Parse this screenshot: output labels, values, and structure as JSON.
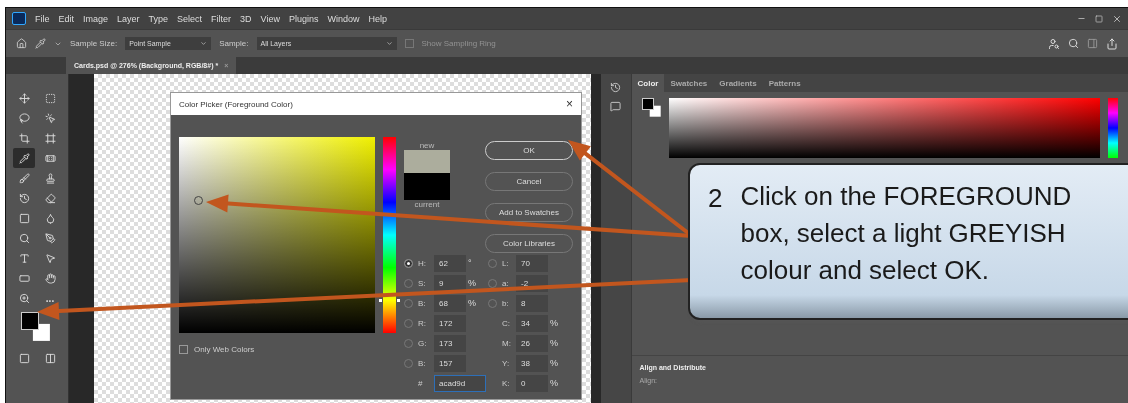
{
  "menu_bar": {
    "items": [
      "File",
      "Edit",
      "Image",
      "Layer",
      "Type",
      "Select",
      "Filter",
      "3D",
      "View",
      "Plugins",
      "Window",
      "Help"
    ]
  },
  "options_bar": {
    "sample_size_label": "Sample Size:",
    "sample_size": "Point Sample",
    "sample_label": "Sample:",
    "sample": "All Layers",
    "sampling_ring": {
      "label": "Show Sampling Ring",
      "checked": false,
      "disabled": true
    }
  },
  "document_tab": {
    "title": "Cards.psd @ 276% (Background, RGB/8#) *",
    "close": "×"
  },
  "toolbar": {
    "tools": [
      {
        "selected": false
      },
      {
        "selected": false
      },
      {
        "selected": false
      },
      {
        "selected": false
      },
      {
        "selected": false
      },
      {
        "selected": false
      },
      {
        "selected": true
      },
      {
        "selected": false
      },
      {
        "selected": false
      },
      {
        "selected": false
      },
      {
        "selected": false
      },
      {
        "selected": false
      },
      {
        "selected": false
      },
      {
        "selected": false
      },
      {
        "selected": false
      },
      {
        "selected": false
      },
      {
        "selected": false
      },
      {
        "selected": false
      },
      {
        "selected": false
      },
      {
        "selected": false
      },
      {
        "selected": false
      },
      {
        "selected": false
      }
    ],
    "more": "..."
  },
  "color_picker": {
    "title": "Color Picker (Foreground Color)",
    "close": "×",
    "hue_slider": {
      "level": 0.17
    },
    "new_label": "new",
    "current_label": "current",
    "buttons": [
      "OK",
      "Cancel",
      "Add to Swatches",
      "Color Libraries"
    ],
    "fields": [
      {
        "label": "H:",
        "value": "62",
        "unit": "°",
        "selected": true
      },
      {
        "label": "S:",
        "value": "9",
        "unit": "%",
        "selected": false
      },
      {
        "label": "B:",
        "value": "68",
        "unit": "%",
        "selected": false
      },
      {
        "label": "R:",
        "value": "172",
        "selected": false
      },
      {
        "label": "G:",
        "value": "173",
        "selected": false
      },
      {
        "label": "B:",
        "value": "157",
        "selected": false
      }
    ],
    "lab_fields": [
      {
        "label": "L:",
        "value": "70",
        "selected": false
      },
      {
        "label": "a:",
        "value": "-2",
        "selected": false
      },
      {
        "label": "b:",
        "value": "8",
        "selected": false
      }
    ],
    "cmyk_fields": [
      {
        "label": "C:",
        "value": "34",
        "unit": "%"
      },
      {
        "label": "M:",
        "value": "26",
        "unit": "%"
      },
      {
        "label": "Y:",
        "value": "38",
        "unit": "%"
      },
      {
        "label": "K:",
        "value": "0",
        "unit": "%"
      }
    ],
    "hex": {
      "label": "#",
      "value": "acad9d"
    },
    "only_web_colors": {
      "label": "Only Web Colors",
      "checked": false
    }
  },
  "right_panel": {
    "tabs": [
      {
        "label": "Color",
        "selected": true
      },
      {
        "label": "Swatches",
        "selected": false
      },
      {
        "label": "Gradients",
        "selected": false
      },
      {
        "label": "Patterns",
        "selected": false
      }
    ],
    "section": "Align and Distribute",
    "align_label": "Align:"
  },
  "callout": {
    "number": "2",
    "text": "Click on the FOREGROUND\nbox, select a light GREYISH\ncolour and select OK."
  }
}
